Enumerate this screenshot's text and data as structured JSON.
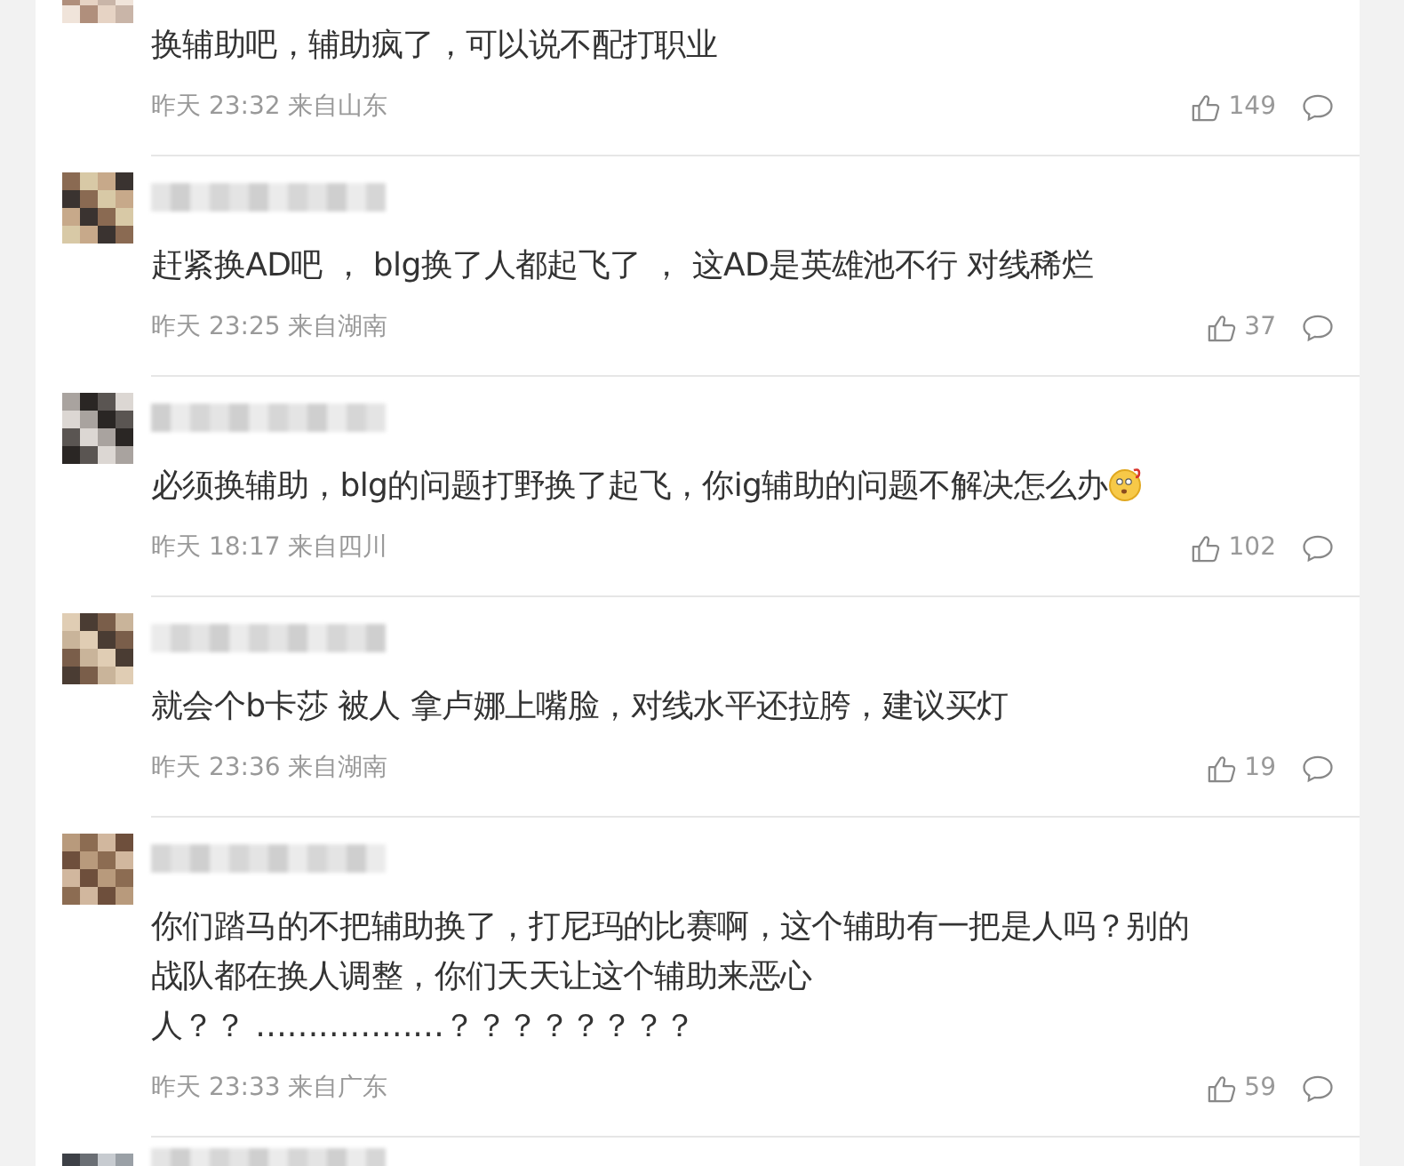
{
  "comments": [
    {
      "kind": "full",
      "text": "换辅助吧，辅助疯了，可以说不配打职业",
      "emoji": false,
      "time": "昨天 23:32",
      "location": "来自山东",
      "likes": "149"
    },
    {
      "kind": "full",
      "text": "赶紧换AD吧 ， blg换了人都起飞了 ， 这AD是英雄池不行 对线稀烂",
      "emoji": false,
      "time": "昨天 23:25",
      "location": "来自湖南",
      "likes": "37"
    },
    {
      "kind": "full",
      "text": "必须换辅助，blg的问题打野换了起飞，你ig辅助的问题不解决怎么办",
      "emoji": true,
      "time": "昨天 18:17",
      "location": "来自四川",
      "likes": "102"
    },
    {
      "kind": "full",
      "text": "就会个b卡莎 被人 拿卢娜上嘴脸，对线水平还拉胯，建议买灯",
      "emoji": false,
      "time": "昨天 23:36",
      "location": "来自湖南",
      "likes": "19"
    },
    {
      "kind": "full",
      "text": "你们踏马的不把辅助换了，打尼玛的比赛啊，这个辅助有一把是人吗？别的战队都在换人调整，你们天天让这个辅助来恶心",
      "text_2": "人？？ ………………？？？？？？？？",
      "emoji": false,
      "time": "昨天 23:33",
      "location": "来自广东",
      "likes": "59"
    },
    {
      "kind": "partial"
    }
  ]
}
